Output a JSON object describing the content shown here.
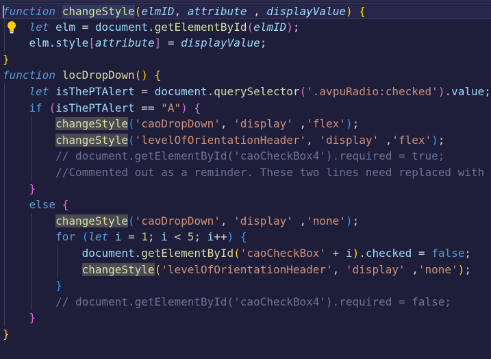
{
  "editor": {
    "language": "javascript",
    "accent_colors": {
      "keyword": "#569cd6",
      "function": "#dcdcaa",
      "parameter": "#9cdcfe",
      "string": "#ce9178",
      "number": "#b5cea8",
      "comment": "#6a7396",
      "background": "#1f1e3a"
    },
    "lines": [
      {
        "tokens": [
          {
            "t": "function",
            "c": "kwi"
          },
          {
            "t": " ",
            "c": "punc"
          },
          {
            "t": "changeStyle",
            "c": "fn hl-cur"
          },
          {
            "t": "(",
            "c": "brk1"
          },
          {
            "t": "elmID",
            "c": "param"
          },
          {
            "t": ", ",
            "c": "punc"
          },
          {
            "t": "attribute",
            "c": "param"
          },
          {
            "t": " , ",
            "c": "punc"
          },
          {
            "t": "displayValue",
            "c": "param"
          },
          {
            "t": ")",
            "c": "brk1"
          },
          {
            "t": " ",
            "c": "punc"
          },
          {
            "t": "{",
            "c": "brk1"
          }
        ]
      },
      {
        "tokens": [
          {
            "t": "    ",
            "c": "punc"
          },
          {
            "t": "let",
            "c": "kwi"
          },
          {
            "t": " ",
            "c": "punc"
          },
          {
            "t": "elm",
            "c": "var"
          },
          {
            "t": " = ",
            "c": "punc"
          },
          {
            "t": "document",
            "c": "var"
          },
          {
            "t": ".",
            "c": "punc"
          },
          {
            "t": "getElementById",
            "c": "fn"
          },
          {
            "t": "(",
            "c": "brk2"
          },
          {
            "t": "elmID",
            "c": "param"
          },
          {
            "t": ")",
            "c": "brk2"
          },
          {
            "t": ";",
            "c": "punc"
          }
        ]
      },
      {
        "tokens": [
          {
            "t": "    ",
            "c": "punc"
          },
          {
            "t": "elm",
            "c": "var"
          },
          {
            "t": ".",
            "c": "punc"
          },
          {
            "t": "style",
            "c": "var"
          },
          {
            "t": "[",
            "c": "brk2"
          },
          {
            "t": "attribute",
            "c": "param"
          },
          {
            "t": "]",
            "c": "brk2"
          },
          {
            "t": " = ",
            "c": "punc"
          },
          {
            "t": "displayValue",
            "c": "param"
          },
          {
            "t": ";",
            "c": "punc"
          }
        ]
      },
      {
        "tokens": [
          {
            "t": "}",
            "c": "brk1"
          }
        ]
      },
      {
        "tokens": [
          {
            "t": "function",
            "c": "kwi"
          },
          {
            "t": " ",
            "c": "punc"
          },
          {
            "t": "locDropDown",
            "c": "fn"
          },
          {
            "t": "()",
            "c": "brk1"
          },
          {
            "t": " ",
            "c": "punc"
          },
          {
            "t": "{",
            "c": "brk1"
          }
        ]
      },
      {
        "tokens": [
          {
            "t": "    ",
            "c": "punc"
          },
          {
            "t": "let",
            "c": "kwi"
          },
          {
            "t": " ",
            "c": "punc"
          },
          {
            "t": "isThePTAlert",
            "c": "var"
          },
          {
            "t": " = ",
            "c": "punc"
          },
          {
            "t": "document",
            "c": "var"
          },
          {
            "t": ".",
            "c": "punc"
          },
          {
            "t": "querySelector",
            "c": "fn"
          },
          {
            "t": "(",
            "c": "brk2"
          },
          {
            "t": "'.avpuRadio:checked'",
            "c": "str"
          },
          {
            "t": ")",
            "c": "brk2"
          },
          {
            "t": ".",
            "c": "punc"
          },
          {
            "t": "value",
            "c": "var"
          },
          {
            "t": ";",
            "c": "punc"
          }
        ]
      },
      {
        "tokens": [
          {
            "t": "    ",
            "c": "punc"
          },
          {
            "t": "if",
            "c": "kw"
          },
          {
            "t": " ",
            "c": "punc"
          },
          {
            "t": "(",
            "c": "brk2"
          },
          {
            "t": "isThePTAlert",
            "c": "var"
          },
          {
            "t": " == ",
            "c": "punc"
          },
          {
            "t": "\"A\"",
            "c": "str"
          },
          {
            "t": ")",
            "c": "brk2"
          },
          {
            "t": " ",
            "c": "punc"
          },
          {
            "t": "{",
            "c": "brk2"
          }
        ]
      },
      {
        "tokens": [
          {
            "t": "        ",
            "c": "punc"
          },
          {
            "t": "changeStyle",
            "c": "fn hl"
          },
          {
            "t": "(",
            "c": "brk3"
          },
          {
            "t": "'caoDropDown'",
            "c": "str"
          },
          {
            "t": ", ",
            "c": "punc"
          },
          {
            "t": "'display'",
            "c": "str"
          },
          {
            "t": " ,",
            "c": "punc"
          },
          {
            "t": "'flex'",
            "c": "str"
          },
          {
            "t": ")",
            "c": "brk3"
          },
          {
            "t": ";",
            "c": "punc"
          }
        ]
      },
      {
        "tokens": [
          {
            "t": "        ",
            "c": "punc"
          },
          {
            "t": "changeStyle",
            "c": "fn hl"
          },
          {
            "t": "(",
            "c": "brk3"
          },
          {
            "t": "'levelOfOrientationHeader'",
            "c": "str"
          },
          {
            "t": ", ",
            "c": "punc"
          },
          {
            "t": "'display'",
            "c": "str"
          },
          {
            "t": " ,",
            "c": "punc"
          },
          {
            "t": "'flex'",
            "c": "str"
          },
          {
            "t": ")",
            "c": "brk3"
          },
          {
            "t": ";",
            "c": "punc"
          }
        ]
      },
      {
        "tokens": [
          {
            "t": "        ",
            "c": "punc"
          },
          {
            "t": "// document.getElementById('caoCheckBox4').required = true;",
            "c": "cmt"
          }
        ]
      },
      {
        "tokens": [
          {
            "t": "        ",
            "c": "punc"
          },
          {
            "t": "//Commented out as a reminder. These two lines need replaced with",
            "c": "cmt"
          }
        ]
      },
      {
        "tokens": [
          {
            "t": "    ",
            "c": "punc"
          },
          {
            "t": "}",
            "c": "brk2"
          }
        ]
      },
      {
        "tokens": [
          {
            "t": "    ",
            "c": "punc"
          },
          {
            "t": "else",
            "c": "kw"
          },
          {
            "t": " ",
            "c": "punc"
          },
          {
            "t": "{",
            "c": "brk2"
          }
        ]
      },
      {
        "tokens": [
          {
            "t": "        ",
            "c": "punc"
          },
          {
            "t": "changeStyle",
            "c": "fn hl"
          },
          {
            "t": "(",
            "c": "brk3"
          },
          {
            "t": "'caoDropDown'",
            "c": "str"
          },
          {
            "t": ", ",
            "c": "punc"
          },
          {
            "t": "'display'",
            "c": "str"
          },
          {
            "t": " ,",
            "c": "punc"
          },
          {
            "t": "'none'",
            "c": "str"
          },
          {
            "t": ")",
            "c": "brk3"
          },
          {
            "t": ";",
            "c": "punc"
          }
        ]
      },
      {
        "tokens": [
          {
            "t": "        ",
            "c": "punc"
          },
          {
            "t": "for",
            "c": "kw"
          },
          {
            "t": " ",
            "c": "punc"
          },
          {
            "t": "(",
            "c": "brk3"
          },
          {
            "t": "let",
            "c": "kwi"
          },
          {
            "t": " ",
            "c": "punc"
          },
          {
            "t": "i",
            "c": "var"
          },
          {
            "t": " = ",
            "c": "punc"
          },
          {
            "t": "1",
            "c": "num"
          },
          {
            "t": "; ",
            "c": "punc"
          },
          {
            "t": "i",
            "c": "var"
          },
          {
            "t": " < ",
            "c": "punc"
          },
          {
            "t": "5",
            "c": "num"
          },
          {
            "t": "; ",
            "c": "punc"
          },
          {
            "t": "i",
            "c": "var"
          },
          {
            "t": "++",
            "c": "punc"
          },
          {
            "t": ")",
            "c": "brk3"
          },
          {
            "t": " ",
            "c": "punc"
          },
          {
            "t": "{",
            "c": "brk3"
          }
        ]
      },
      {
        "tokens": [
          {
            "t": "            ",
            "c": "punc"
          },
          {
            "t": "document",
            "c": "var"
          },
          {
            "t": ".",
            "c": "punc"
          },
          {
            "t": "getElementById",
            "c": "fn"
          },
          {
            "t": "(",
            "c": "brk1"
          },
          {
            "t": "'caoCheckBox'",
            "c": "str"
          },
          {
            "t": " + ",
            "c": "punc"
          },
          {
            "t": "i",
            "c": "var"
          },
          {
            "t": ")",
            "c": "brk1"
          },
          {
            "t": ".",
            "c": "punc"
          },
          {
            "t": "checked",
            "c": "var"
          },
          {
            "t": " = ",
            "c": "punc"
          },
          {
            "t": "false",
            "c": "kw"
          },
          {
            "t": ";",
            "c": "punc"
          }
        ]
      },
      {
        "tokens": [
          {
            "t": "            ",
            "c": "punc"
          },
          {
            "t": "changeStyle",
            "c": "fn hl"
          },
          {
            "t": "(",
            "c": "brk1"
          },
          {
            "t": "'levelOfOrientationHeader'",
            "c": "str"
          },
          {
            "t": ", ",
            "c": "punc"
          },
          {
            "t": "'display'",
            "c": "str"
          },
          {
            "t": " ,",
            "c": "punc"
          },
          {
            "t": "'none'",
            "c": "str"
          },
          {
            "t": ")",
            "c": "brk1"
          },
          {
            "t": ";",
            "c": "punc"
          }
        ]
      },
      {
        "tokens": [
          {
            "t": "        ",
            "c": "punc"
          },
          {
            "t": "}",
            "c": "brk3"
          }
        ]
      },
      {
        "tokens": [
          {
            "t": "        ",
            "c": "punc"
          },
          {
            "t": "// document.getElementById('caoCheckBox4').required = false;",
            "c": "cmt"
          }
        ]
      },
      {
        "tokens": [
          {
            "t": "    ",
            "c": "punc"
          },
          {
            "t": "}",
            "c": "brk2"
          }
        ]
      },
      {
        "tokens": [
          {
            "t": "}",
            "c": "brk1"
          }
        ]
      }
    ],
    "lightbulb_icon": "lightbulb-icon"
  }
}
